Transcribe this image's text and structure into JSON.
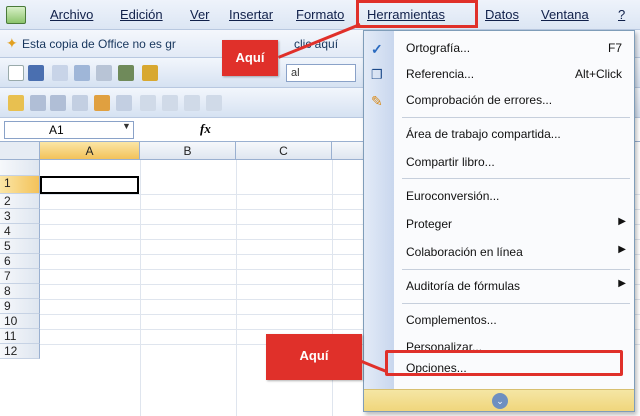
{
  "menubar": {
    "items": [
      "Archivo",
      "Edición",
      "Ver",
      "Insertar",
      "Formato",
      "Herramientas",
      "Datos",
      "Ventana",
      "?"
    ]
  },
  "notice": {
    "text": "Esta copia de Office no es gr",
    "text_tail": "clic aquí"
  },
  "toolbar": {
    "font_label": "al"
  },
  "formula": {
    "cell_ref": "A1",
    "fx": "fx"
  },
  "grid": {
    "columns": [
      "A",
      "B",
      "C"
    ],
    "rows": [
      "1",
      "2",
      "3",
      "4",
      "5",
      "6",
      "7",
      "8",
      "9",
      "10",
      "11",
      "12"
    ],
    "selected_cell": "A1"
  },
  "dropdown": {
    "items": [
      {
        "label": "Ortografía...",
        "shortcut": "F7",
        "icon": "spellcheck-icon"
      },
      {
        "label": "Referencia...",
        "shortcut": "Alt+Click",
        "icon": "research-icon"
      },
      {
        "label": "Comprobación de errores...",
        "icon": "error-check-icon"
      },
      {
        "label": "Área de trabajo compartida..."
      },
      {
        "label": "Compartir libro..."
      },
      {
        "label": "Euroconversión..."
      },
      {
        "label": "Proteger",
        "submenu": true
      },
      {
        "label": "Colaboración en línea",
        "submenu": true
      },
      {
        "label": "Auditoría de fórmulas",
        "submenu": true
      },
      {
        "label": "Complementos..."
      },
      {
        "label": "Personalizar..."
      },
      {
        "label": "Opciones..."
      }
    ]
  },
  "callouts": {
    "top": "Aquí",
    "bottom": "Aquí"
  },
  "colors": {
    "highlight": "#e0302a",
    "menu_gutter": "#c9d7ee",
    "active_header": "#f3c25a"
  }
}
